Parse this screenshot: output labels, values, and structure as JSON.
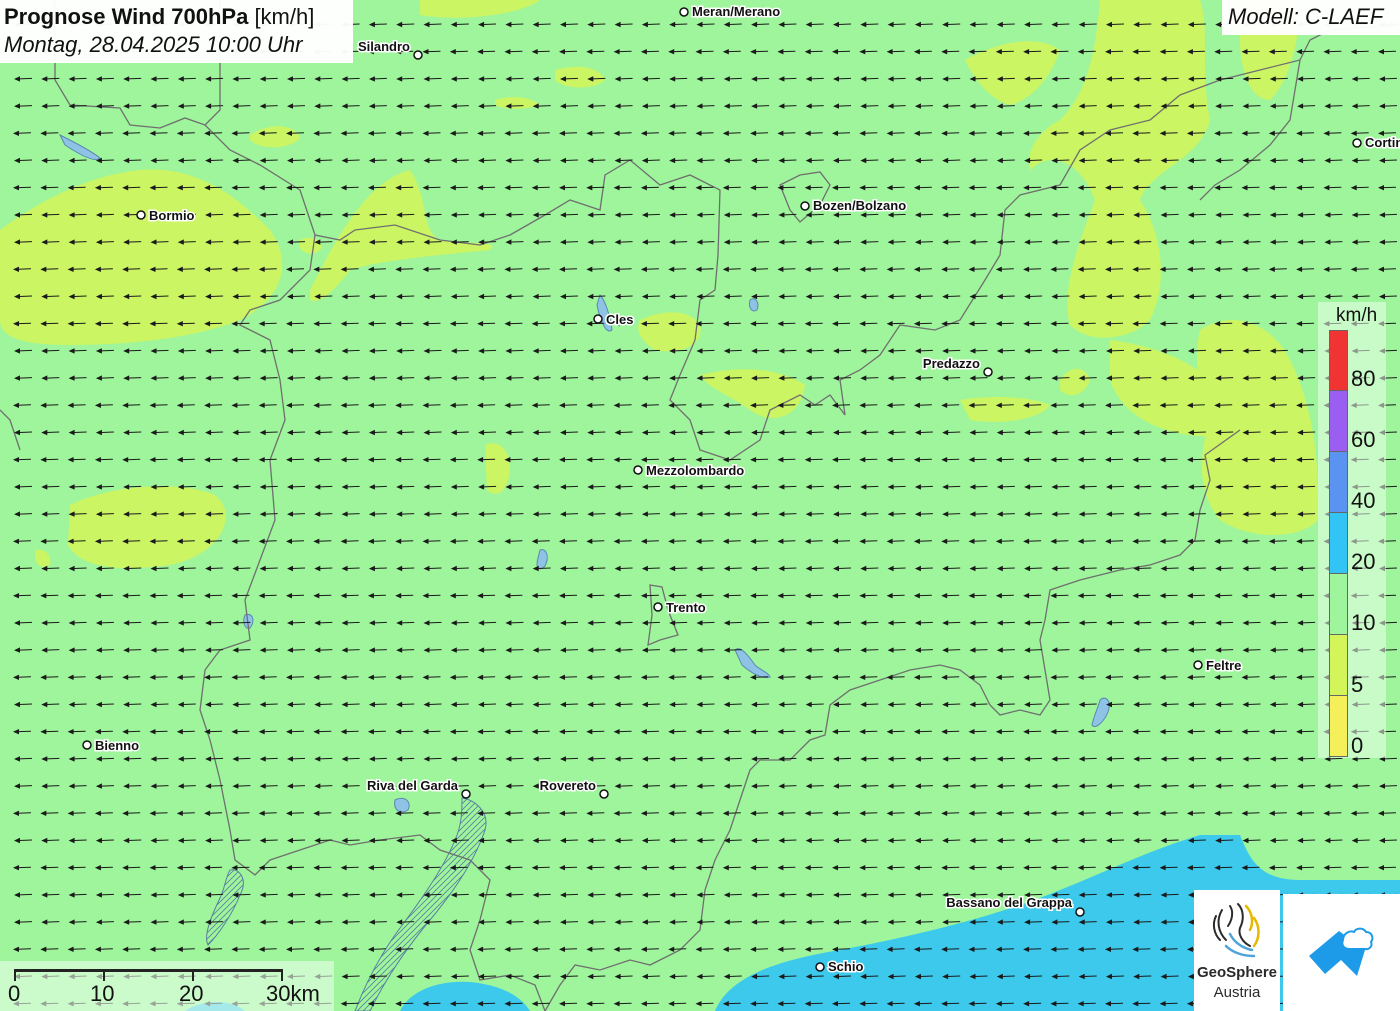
{
  "header": {
    "title_bold": "Prognose Wind 700hPa",
    "title_unit": "[km/h]",
    "subtitle": "Montag, 28.04.2025 10:00 Uhr"
  },
  "model_label": "Modell: C-LAEF",
  "legend": {
    "unit": "km/h",
    "classes": [
      {
        "label": "80",
        "color": "#f03434"
      },
      {
        "label": "60",
        "color": "#9a5ef0"
      },
      {
        "label": "40",
        "color": "#5a94f0"
      },
      {
        "label": "20",
        "color": "#31c4f5"
      },
      {
        "label": "10",
        "color": "#9ef59b"
      },
      {
        "label": "5",
        "color": "#d4f55a"
      },
      {
        "label": "0",
        "color": "#f5f05a"
      }
    ]
  },
  "scale": {
    "labels": [
      "0",
      "10",
      "20",
      "30km"
    ]
  },
  "cities": [
    {
      "name": "Meran/Merano"
    },
    {
      "name": "Silandro"
    },
    {
      "name": "Bormio"
    },
    {
      "name": "Bozen/Bolzano"
    },
    {
      "name": "Cortin"
    },
    {
      "name": "Cles"
    },
    {
      "name": "Predazzo"
    },
    {
      "name": "Mezzolombardo"
    },
    {
      "name": "Trento"
    },
    {
      "name": "Feltre"
    },
    {
      "name": "Bienno"
    },
    {
      "name": "Riva del Garda"
    },
    {
      "name": "Rovereto"
    },
    {
      "name": "Bassano del Grappa"
    },
    {
      "name": "Schio"
    }
  ],
  "logos": {
    "geosphere_line1": "GeoSphere",
    "geosphere_line2": "Austria"
  },
  "wind": {
    "direction": "east-to-west",
    "arrow_color": "#1a1a1a"
  },
  "colors": {
    "background_wind_class_10": "#9ef59b",
    "wind_class_5": "#d4f55a",
    "wind_class_20": "#31c4f5",
    "border_line": "#6f6f6f",
    "lake": "#8ec3e6"
  }
}
